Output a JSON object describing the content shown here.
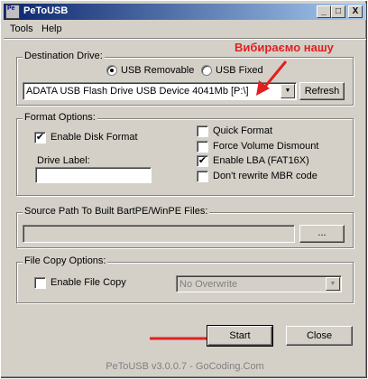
{
  "window": {
    "title": "PeToUSB",
    "icon_text": "Pe"
  },
  "titlebar_buttons": {
    "minimize": "_",
    "maximize": "□",
    "close": "X"
  },
  "menu": [
    "Tools",
    "Help"
  ],
  "destination": {
    "legend": "Destination Drive:",
    "radio_removable": "USB Removable",
    "radio_fixed": "USB Fixed",
    "drive_value": "ADATA USB Flash Drive USB Device 4041Mb [P:\\]",
    "refresh": "Refresh",
    "annotation": "Вибираємо нашу"
  },
  "format": {
    "legend": "Format Options:",
    "enable_disk_format": "Enable Disk Format",
    "drive_label": "Drive Label:",
    "quick_format": "Quick Format",
    "force_dismount": "Force Volume Dismount",
    "enable_lba": "Enable LBA (FAT16X)",
    "dont_rewrite_mbr": "Don't rewrite MBR code",
    "checked_mark": "✔"
  },
  "source": {
    "legend": "Source Path To Built BartPE/WinPE Files:",
    "browse": "..."
  },
  "file_copy": {
    "legend": "File Copy Options:",
    "enable_file_copy": "Enable File Copy",
    "overwrite_value": "No Overwrite"
  },
  "actions": {
    "start": "Start",
    "close": "Close"
  },
  "footer": "PeToUSB v3.0.0.7 - GoCoding.Com",
  "colors": {
    "annotation": "#e02020",
    "titlebar_start": "#0a246a",
    "titlebar_end": "#a6caf0"
  }
}
